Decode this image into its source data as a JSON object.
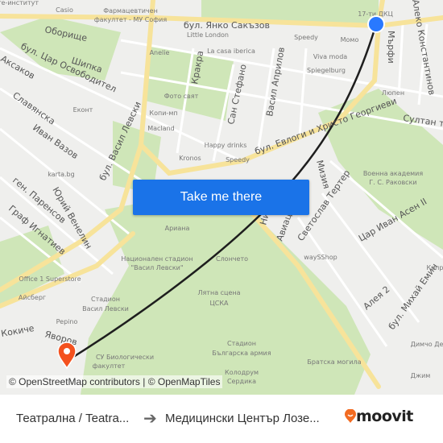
{
  "map": {
    "streets": [
      "бул. Янко Сакъзов",
      "Оборище",
      "Шипка",
      "бул. Цар Освободител",
      "Аксаков",
      "Славянска",
      "Иван Вазов",
      "Кракра",
      "Сан Стефано",
      "Васил Априлов",
      "бул. Евлоги и Христо Георгиеви",
      "Мърфи",
      "Алеко Константинов",
      "Султан т",
      "бул. Васил Левски",
      "Юрий Венелин",
      "ген. Паренсов",
      "Граф Игнатиев",
      "Мизия",
      "Светослав Тертер",
      "Авиац",
      "Ни",
      "Цар Иван Асен II",
      "Алея 2",
      "бул. Михай Емин",
      "Кокиче",
      "Яворов"
    ],
    "pois": [
      "Casio",
      "Фармацевтичен",
      "факултет - МУ София",
      "Little London",
      "Speedy",
      "Момо",
      "17-ти ДКЦ",
      "Anelie",
      "La casa iberica",
      "Viva moda",
      "Spiegelburg",
      "Люпен",
      "Фото свят",
      "Копи-мп",
      "Еконт",
      "Macland",
      "Happy drinks",
      "Kronos",
      "Speedy",
      "karta.bg",
      "Военна академия",
      "Г. С. Раковски",
      "Ариана",
      "Национален стадион",
      "\"Васил Левски\"",
      "Слончето",
      "waySShop",
      "Office 1 Superstore",
      "Айсберг",
      "Стадион",
      "Васил Левски",
      "Лятна сцена",
      "ЦСКА",
      "Pepino",
      "СУ Биологически",
      "факултет",
      "Стадион",
      "Българска армия",
      "Братска могила",
      "Колодрум",
      "Сердика",
      "Димчо Де",
      "Джим",
      "Капр",
      "оте-институт"
    ]
  },
  "route": {
    "origin_color": "#2979ff",
    "destination_color": "#f4511e",
    "line_color": "#1e1e1e"
  },
  "cta": {
    "label": "Take me there"
  },
  "attribution": "© OpenStreetMap contributors | © OpenMapTiles",
  "footer": {
    "from": "Театрална / Teatra...",
    "arrow_icon": "arrow-right-icon",
    "to": "Медицински Център Лозе...",
    "brand": "moovit",
    "brand_color": "#f26b21"
  }
}
